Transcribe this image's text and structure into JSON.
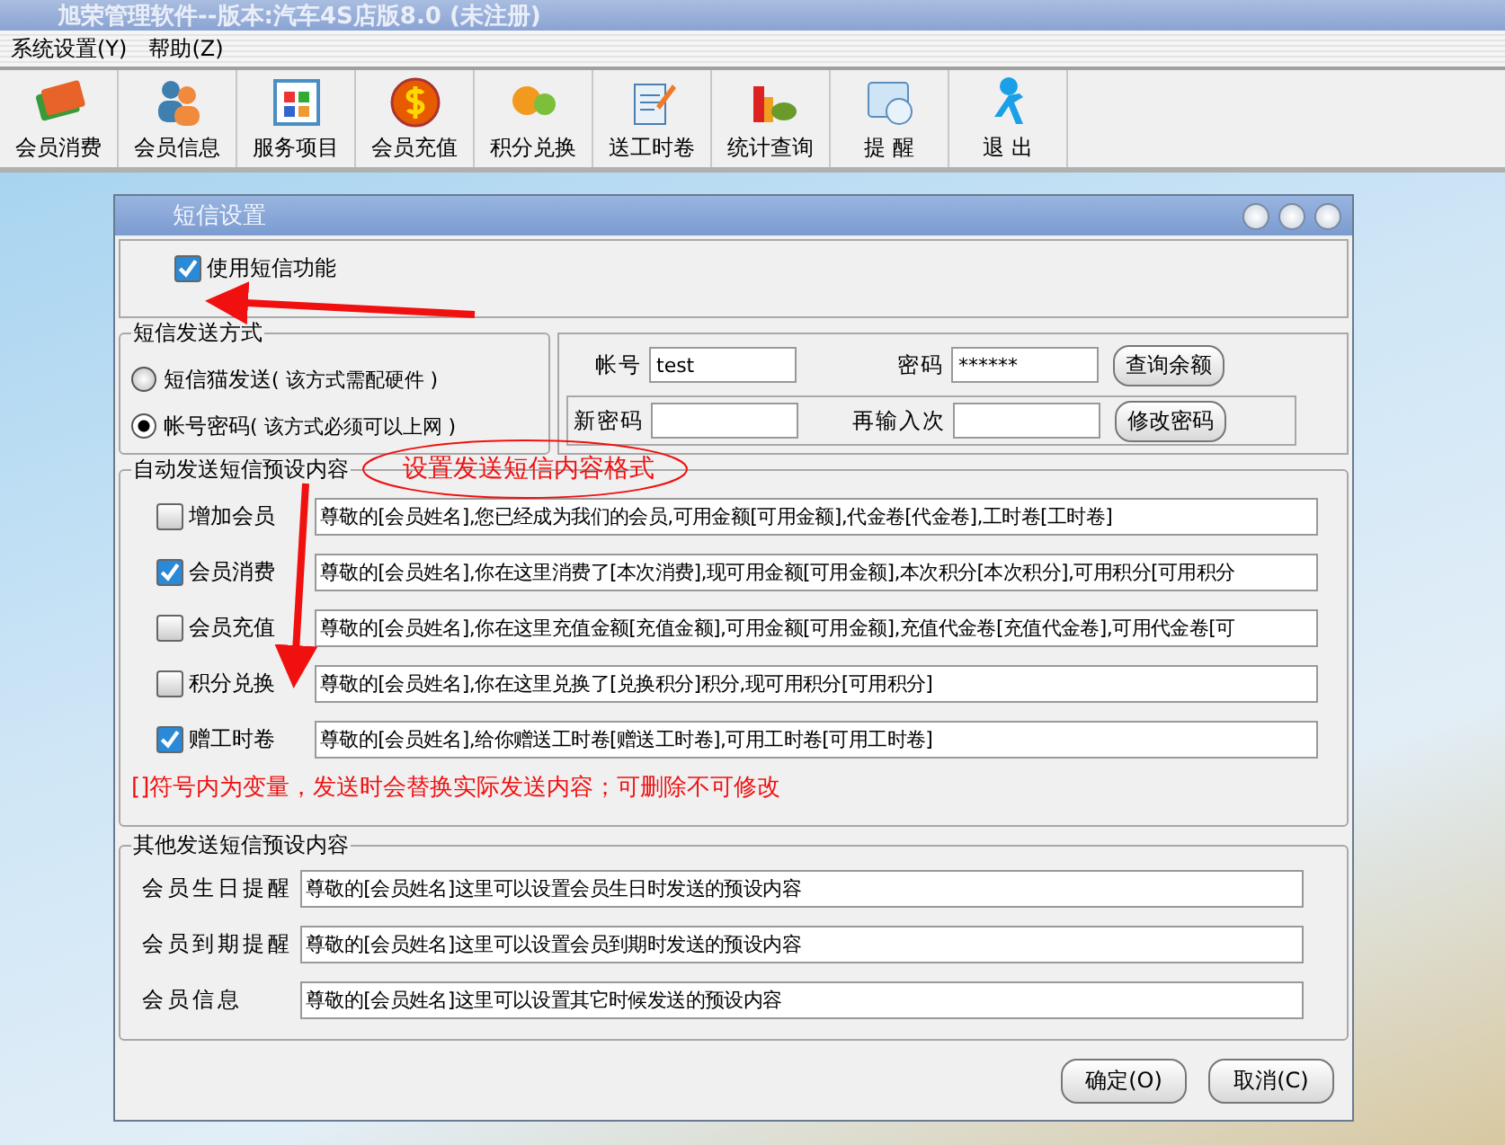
{
  "app_title": "旭荣管理软件--版本:汽车4S店版8.0 (未注册)",
  "menu": [
    "系统设置(Y)",
    "帮助(Z)"
  ],
  "toolbar": [
    {
      "label": "会员消费"
    },
    {
      "label": "会员信息"
    },
    {
      "label": "服务项目"
    },
    {
      "label": "会员充值"
    },
    {
      "label": "积分兑换"
    },
    {
      "label": "送工时卷"
    },
    {
      "label": "统计查询"
    },
    {
      "label": "提 醒"
    },
    {
      "label": "退 出"
    }
  ],
  "dialog": {
    "title": "短信设置",
    "enable": {
      "label": "使用短信功能",
      "checked": true
    },
    "send_mode": {
      "legend": "短信发送方式",
      "options": [
        {
          "label": "短信猫发送",
          "note": "( 该方式需配硬件 )",
          "selected": false
        },
        {
          "label": "帐号密码",
          "note": "( 该方式必须可以上网 )",
          "selected": true
        }
      ]
    },
    "account": {
      "account_label": "帐号",
      "account_value": "test",
      "password_label": "密码",
      "password_value": "******",
      "query_button": "查询余额",
      "new_password_label": "新密码",
      "repeat_label": "再输入次",
      "change_button": "修改密码"
    },
    "auto": {
      "legend": "自动发送短信预设内容",
      "items": [
        {
          "label": "增加会员",
          "checked": false,
          "text": "尊敬的[会员姓名],您已经成为我们的会员,可用金额[可用金额],代金卷[代金卷],工时卷[工时卷]"
        },
        {
          "label": "会员消费",
          "checked": true,
          "text": "尊敬的[会员姓名],你在这里消费了[本次消费],现可用金额[可用金额],本次积分[本次积分],可用积分[可用积分"
        },
        {
          "label": "会员充值",
          "checked": false,
          "text": "尊敬的[会员姓名],你在这里充值金额[充值金额],可用金额[可用金额],充值代金卷[充值代金卷],可用代金卷[可"
        },
        {
          "label": "积分兑换",
          "checked": false,
          "text": "尊敬的[会员姓名],你在这里兑换了[兑换积分]积分,现可用积分[可用积分]"
        },
        {
          "label": "赠工时卷",
          "checked": true,
          "text": "尊敬的[会员姓名],给你赠送工时卷[赠送工时卷],可用工时卷[可用工时卷]"
        }
      ],
      "note": "[]符号内为变量，发送时会替换实际发送内容；可删除不可修改"
    },
    "other": {
      "legend": "其他发送短信预设内容",
      "items": [
        {
          "label": "会员生日提醒",
          "text": "尊敬的[会员姓名]这里可以设置会员生日时发送的预设内容"
        },
        {
          "label": "会员到期提醒",
          "text": "尊敬的[会员姓名]这里可以设置会员到期时发送的预设内容"
        },
        {
          "label": "会员信息",
          "text": "尊敬的[会员姓名]这里可以设置其它时候发送的预设内容"
        }
      ]
    },
    "buttons": [
      "确定(O)",
      "取消(C)"
    ]
  },
  "annotation": {
    "text": "设置发送短信内容格式"
  }
}
